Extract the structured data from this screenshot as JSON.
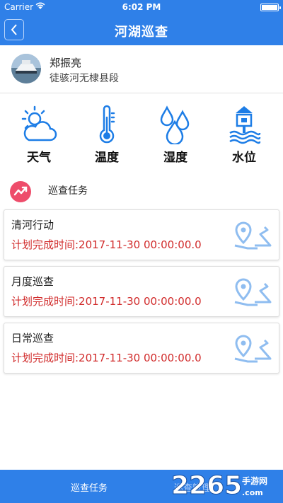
{
  "status_bar": {
    "carrier": "Carrier",
    "time": "6:02 PM"
  },
  "nav": {
    "title": "河湖巡查",
    "back_icon": "chevron-left-icon"
  },
  "user": {
    "name": "郑振亮",
    "section": "徒骇河无棣县段"
  },
  "categories": [
    {
      "label": "天气",
      "icon": "weather-icon"
    },
    {
      "label": "温度",
      "icon": "thermometer-icon"
    },
    {
      "label": "湿度",
      "icon": "humidity-icon"
    },
    {
      "label": "水位",
      "icon": "water-level-icon"
    }
  ],
  "section": {
    "title": "巡查任务",
    "icon": "trend-icon"
  },
  "tasks": [
    {
      "name": "清河行动",
      "time": "计划完成时间:2017-11-30 00:00:00.0"
    },
    {
      "name": "月度巡查",
      "time": "计划完成时间:2017-11-30 00:00:00.0"
    },
    {
      "name": "日常巡查",
      "time": "计划完成时间:2017-11-30 00:00:00.0"
    }
  ],
  "tab_bar": {
    "tab1": "巡查任务",
    "tab2": "巡查管理"
  },
  "watermark": {
    "text": "2265",
    "sub": "手游网",
    "domain": ".com"
  },
  "colors": {
    "primary": "#2f80e8",
    "accent_red": "#d12b2b",
    "icon_blue": "#1d7de6",
    "map_icon": "#8fbdf0",
    "section_icon": "#ee4d6b"
  }
}
